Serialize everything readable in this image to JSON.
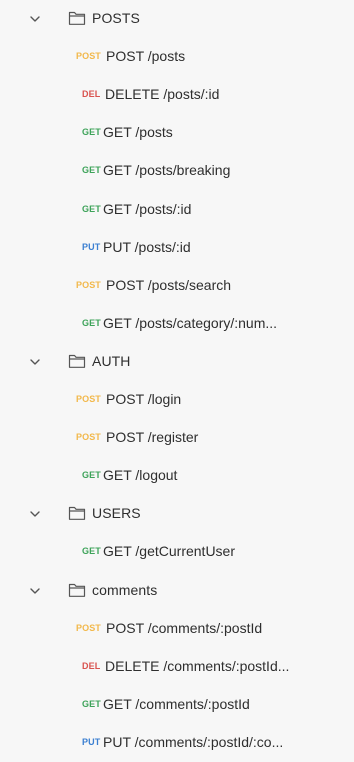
{
  "colors": {
    "POST": "#f2b84b",
    "DEL": "#d9534f",
    "GET": "#3ea35a",
    "PUT": "#3b7fd1"
  },
  "folders": [
    {
      "name": "POSTS",
      "requests": [
        {
          "method": "POST",
          "label": "POST /posts"
        },
        {
          "method": "DEL",
          "label": "DELETE /posts/:id"
        },
        {
          "method": "GET",
          "label": "GET /posts"
        },
        {
          "method": "GET",
          "label": "GET /posts/breaking"
        },
        {
          "method": "GET",
          "label": "GET /posts/:id"
        },
        {
          "method": "PUT",
          "label": "PUT /posts/:id"
        },
        {
          "method": "POST",
          "label": "POST /posts/search"
        },
        {
          "method": "GET",
          "label": "GET /posts/category/:num..."
        }
      ]
    },
    {
      "name": "AUTH",
      "requests": [
        {
          "method": "POST",
          "label": "POST /login"
        },
        {
          "method": "POST",
          "label": "POST /register"
        },
        {
          "method": "GET",
          "label": "GET /logout"
        }
      ]
    },
    {
      "name": "USERS",
      "requests": [
        {
          "method": "GET",
          "label": "GET /getCurrentUser"
        }
      ]
    },
    {
      "name": "comments",
      "requests": [
        {
          "method": "POST",
          "label": "POST /comments/:postId"
        },
        {
          "method": "DEL",
          "label": "DELETE /comments/:postId..."
        },
        {
          "method": "GET",
          "label": "GET /comments/:postId"
        },
        {
          "method": "PUT",
          "label": "PUT /comments/:postId/:co..."
        }
      ]
    }
  ]
}
